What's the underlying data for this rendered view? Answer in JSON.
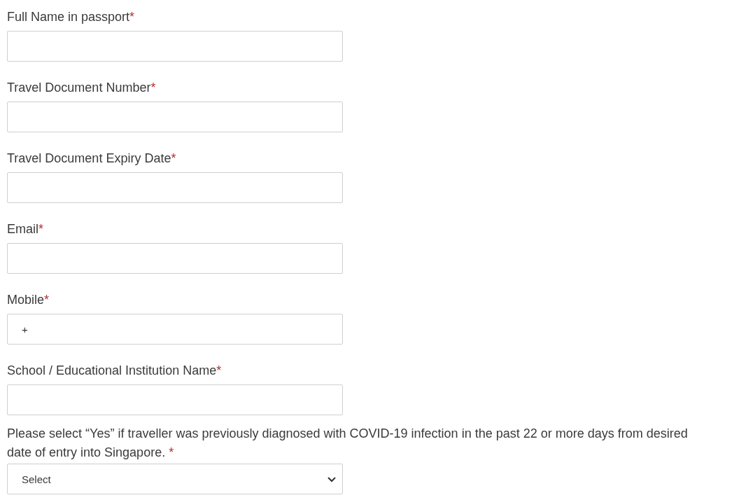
{
  "fields": [
    {
      "label": "Full Name in passport",
      "required_mark": "*"
    },
    {
      "label": "Travel Document Number",
      "required_mark": "*"
    },
    {
      "label": "Travel Document Expiry Date",
      "required_mark": "*"
    },
    {
      "label": "Email",
      "required_mark": "*"
    },
    {
      "label": "Mobile",
      "required_mark": "*",
      "value": "+"
    },
    {
      "label": "School / Educational Institution Name",
      "required_mark": "*"
    }
  ],
  "question": {
    "label": "Please select “Yes” if traveller was previously diagnosed with COVID-19 infection in the past 22 or more days from desired date of entry into Singapore.",
    "required_mark": "*",
    "value": "Select"
  }
}
